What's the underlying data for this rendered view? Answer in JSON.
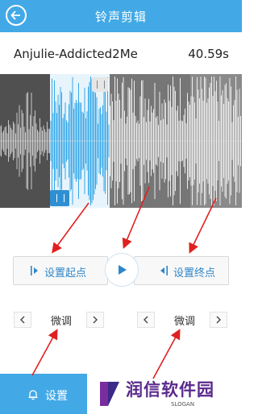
{
  "header": {
    "title": "铃声剪辑"
  },
  "song": {
    "name": "Anjulie-Addicted2Me",
    "duration": "40.59s"
  },
  "controls": {
    "set_start_label": "设置起点",
    "set_end_label": "设置终点"
  },
  "fine_tune": {
    "left_label": "微调",
    "right_label": "微调"
  },
  "bottom": {
    "settings_label": "设置",
    "logo_title": "润信软件园",
    "logo_sub": "SLOGAN"
  },
  "colors": {
    "accent": "#42a9e6",
    "selection": "#36a8e8",
    "annotation": "#e02020",
    "brand": "#5a2a8c"
  }
}
